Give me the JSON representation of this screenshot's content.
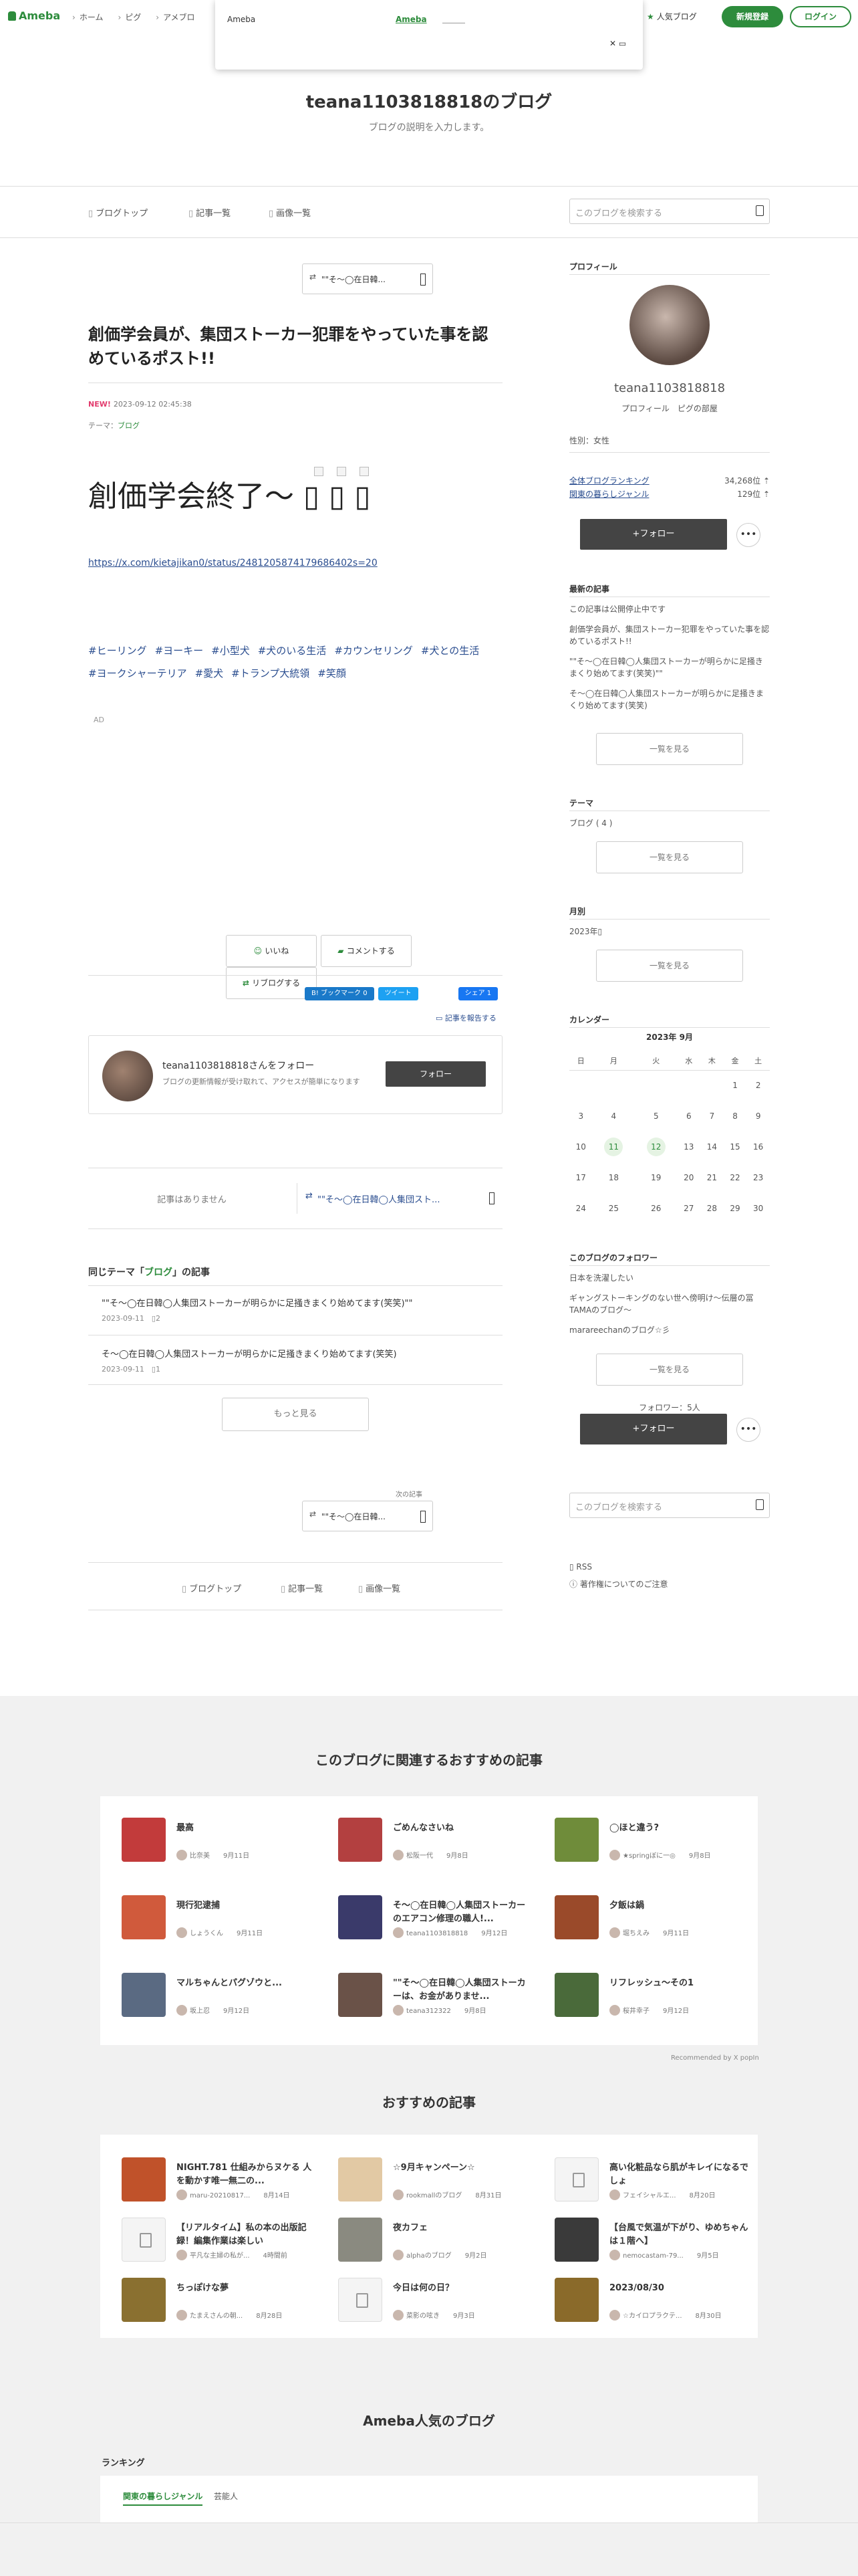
{
  "global_header": {
    "logo": "Ameba",
    "nav": [
      "ホーム",
      "ピグ",
      "アメブロ"
    ],
    "popular_blogs": "人気ブログ",
    "register": "新規登録",
    "login": "ログイン"
  },
  "popup": {
    "title": "Ameba",
    "link": "Ameba",
    "close": "✕ ▭"
  },
  "blog_header": {
    "title": "teana1103818818のブログ",
    "description": "ブログの説明を入力します。"
  },
  "top_nav": {
    "items": [
      "ブログトップ",
      "記事一覧",
      "画像一覧"
    ],
    "search_placeholder": "このブログを検索する"
  },
  "article": {
    "prev_button": "\"\"そ〜◯在日韓...",
    "title": "創価学会員が、集団ストーカー犯罪をやっていた事を認めているポスト!!",
    "new_badge": "NEW!",
    "datetime": "2023-09-12 02:45:38",
    "theme_label": "テーマ：",
    "theme": "ブログ",
    "heading": "創価学会終了〜 ▯ ▯ ▯",
    "link": "https://x.com/kietajikan0/status/2481205874179686402s=20",
    "tags": [
      "#ヒーリング",
      "#ヨーキー",
      "#小型犬",
      "#犬のいる生活",
      "#カウンセリング",
      "#犬との生活",
      "#ヨークシャーテリア",
      "#愛犬",
      "#トランプ大統領",
      "#笑顔"
    ],
    "ad": "AD",
    "actions": {
      "like": "いいね",
      "comment": "コメントする",
      "reblog": "リブログする"
    },
    "badges": {
      "bookmark": "B! ブックマーク 0",
      "tweet": "ツイート",
      "share": "シェア 1"
    },
    "report": "記事を報告する",
    "follow_card": {
      "name": "teana1103818818さんをフォロー",
      "desc": "ブログの更新情報が受け取れて、アクセスが簡単になります",
      "button": "フォロー"
    },
    "prev_next": {
      "none": "記事はありません",
      "next": "\"\"そ〜◯在日韓◯人集団スト..."
    },
    "same_theme": {
      "prefix": "同じテーマ「",
      "theme": "ブログ",
      "suffix": "」の記事"
    },
    "same_items": [
      {
        "title": "\"\"そ〜◯在日韓◯人集団ストーカーが明らかに足掻きまくり始めてます(笑笑)\"\"",
        "date": "2023-09-11",
        "comments": "2"
      },
      {
        "title": "そ〜◯在日韓◯人集団ストーカーが明らかに足掻きまくり始めてます(笑笑)",
        "date": "2023-09-11",
        "comments": "1"
      }
    ],
    "more": "もっと見る",
    "next_label": "次の記事",
    "next_button": "\"\"そ〜◯在日韓...",
    "footer_nav": [
      "ブログトップ",
      "記事一覧",
      "画像一覧"
    ]
  },
  "sidebar": {
    "profile_title": "プロフィール",
    "name": "teana1103818818",
    "links": "プロフィール　ピグの部屋",
    "sex": "性別：女性",
    "rank_all": {
      "label": "全体ブログランキング",
      "value": "34,268位 ⇡"
    },
    "rank_genre": {
      "label": "関東の暮らしジャンル",
      "value": "129位 ⇡"
    },
    "follow": "+フォロー",
    "dots": "•••",
    "recent_title": "最新の記事",
    "recent": [
      "この記事は公開停止中です",
      "創価学会員が、集団ストーカー犯罪をやっていた事を認めているポスト!!",
      "\"\"そ〜◯在日韓◯人集団ストーカーが明らかに足掻きまくり始めてます(笑笑)\"\"",
      "そ〜◯在日韓◯人集団ストーカーが明らかに足掻きまくり始めてます(笑笑)"
    ],
    "see_all": "一覧を見る",
    "theme_title": "テーマ",
    "theme_item": "ブログ ( 4 )",
    "month_title": "月別",
    "month_item": "2023年▯",
    "calendar_title": "カレンダー",
    "calendar_month": "2023年 9月",
    "weekdays": [
      "日",
      "月",
      "火",
      "水",
      "木",
      "金",
      "土"
    ],
    "weeks": [
      [
        "",
        "",
        "",
        "",
        "",
        "1",
        "2"
      ],
      [
        "3",
        "4",
        "5",
        "6",
        "7",
        "8",
        "9"
      ],
      [
        "10",
        "11",
        "12",
        "13",
        "14",
        "15",
        "16"
      ],
      [
        "17",
        "18",
        "19",
        "20",
        "21",
        "22",
        "23"
      ],
      [
        "24",
        "25",
        "26",
        "27",
        "28",
        "29",
        "30"
      ]
    ],
    "highlighted_days": [
      "11",
      "12"
    ],
    "followers_title": "このブログのフォロワー",
    "followers": [
      "日本を洗濯したい",
      "ギャングストーキングのない世へ傍明け〜伝層の冨TAMAのブログ〜",
      "marareechanのブログ☆彡"
    ],
    "follower_count": "フォロワー：5人",
    "search_placeholder": "このブログを検索する",
    "rss": "RSS",
    "copyright": "著作権についてのご注意"
  },
  "related": {
    "title": "このブログに関連するおすすめの記事",
    "items": [
      {
        "title": "最高",
        "author": "比奈美",
        "date": "9月11日",
        "color": "#c23b3b"
      },
      {
        "title": "ごめんなさいね",
        "author": "松阪一代",
        "date": "9月8日",
        "color": "#b34040"
      },
      {
        "title": "◯ほと違う?",
        "author": "★springぼに一◎",
        "date": "9月8日",
        "color": "#6f8c3a"
      },
      {
        "title": "現行犯逮捕",
        "author": "しょうくん",
        "date": "9月11日",
        "color": "#d05a3c"
      },
      {
        "title": "そ〜◯在日韓◯人集団ストーカーのエアコン修理の職人!...",
        "author": "teana1103818818",
        "date": "9月12日",
        "color": "#3a3a6a"
      },
      {
        "title": "夕飯は鍋",
        "author": "堀ちえみ",
        "date": "9月11日",
        "color": "#9a4a2a"
      },
      {
        "title": "マルちゃんとパグゾウと...",
        "author": "坂上忍",
        "date": "9月12日",
        "color": "#5a6a82"
      },
      {
        "title": "\"\"そ〜◯在日韓◯人集団ストーカーは、お金がありませ...",
        "author": "teana312322",
        "date": "9月8日",
        "color": "#6a5248"
      },
      {
        "title": "リフレッシュ〜その1",
        "author": "桜井幸子",
        "date": "9月12日",
        "color": "#4a6a3a"
      }
    ],
    "recommended_by": "Recommended by X popIn"
  },
  "recommend": {
    "title": "おすすめの記事",
    "items": [
      {
        "title": "NIGHT.781 仕組みからヌケる 人を動かす唯一無二の...",
        "author": "maru-20210817...",
        "date": "8月14日",
        "color": "#c0522a"
      },
      {
        "title": "☆9月キャンペーン☆",
        "author": "rookmallのブログ",
        "date": "8月31日",
        "color": "#e2c9a4"
      },
      {
        "title": "高い化粧品なら肌がキレイになるでしょ",
        "author": "フェイシャルエ...",
        "date": "8月20日",
        "color": ""
      },
      {
        "title": "【リアルタイム】私の本の出版記録！編集作業は楽しい",
        "author": "平凡な主婦の私が...",
        "date": "4時間前",
        "color": ""
      },
      {
        "title": "夜カフェ",
        "author": "alphaのブログ",
        "date": "9月2日",
        "color": "#8a8a80"
      },
      {
        "title": "【台風で気温が下がり、ゆめちゃんは１階へ】",
        "author": "nemocastam-79...",
        "date": "9月5日",
        "color": "#3a3a3a"
      },
      {
        "title": "ちっぽけな夢",
        "author": "たまえさんの朝...",
        "date": "8月28日",
        "color": "#8a7030"
      },
      {
        "title": "今日は何の日？",
        "author": "菜影の呟き",
        "date": "9月3日",
        "color": ""
      },
      {
        "title": "2023/08/30",
        "author": "☆カイロプラクテ...",
        "date": "8月30日",
        "color": "#8a6a2a"
      }
    ]
  },
  "popular": {
    "title": "Ameba人気のブログ",
    "ranking": "ランキング",
    "tabs": [
      "関東の暮らしジャンル",
      "芸能人"
    ]
  }
}
